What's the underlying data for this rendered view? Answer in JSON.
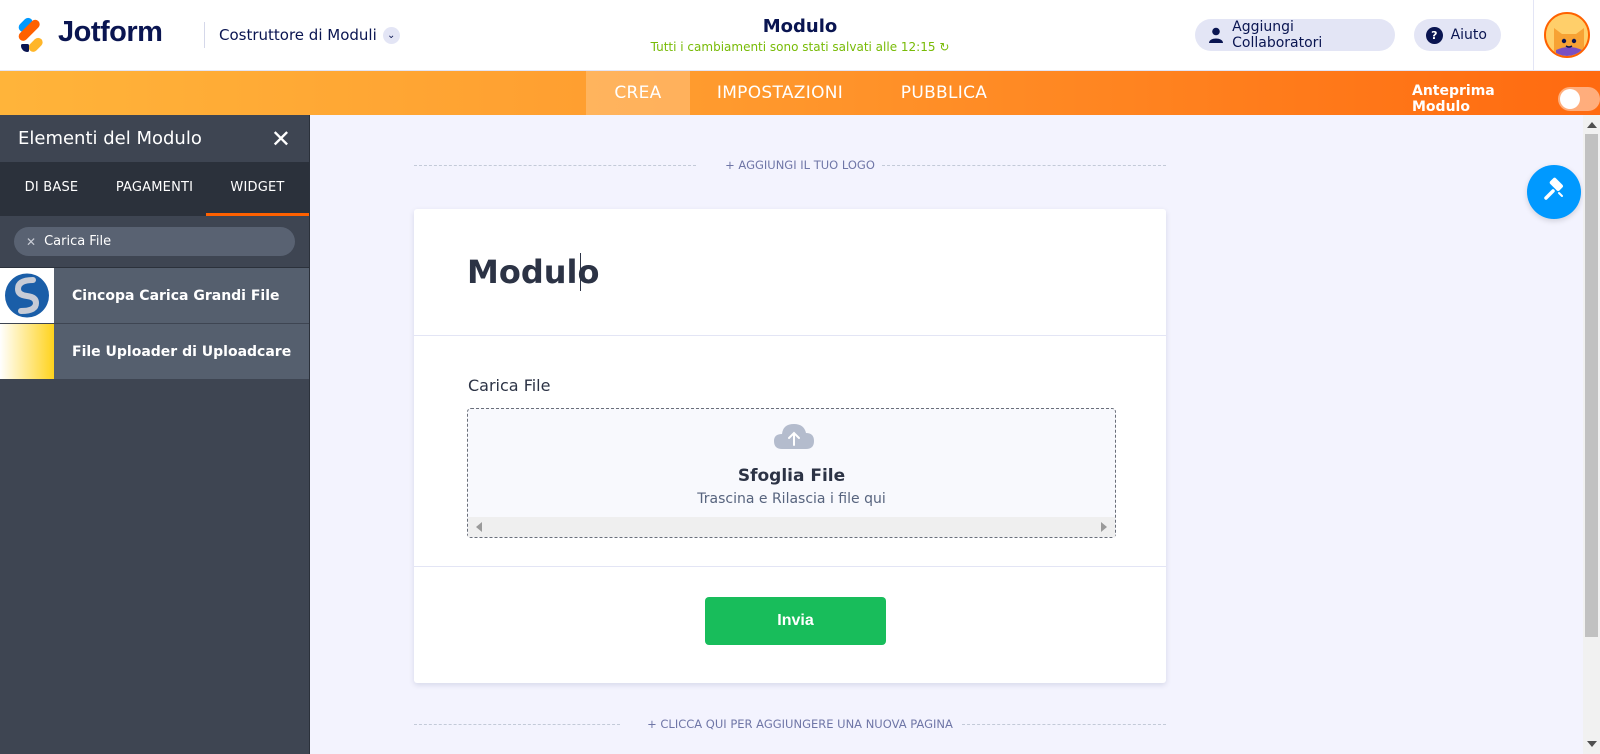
{
  "header": {
    "brand": "Jotform",
    "builder_label": "Costruttore di Moduli",
    "form_title": "Modulo",
    "save_status": "Tutti i cambiamenti sono stati salvati alle 12:15",
    "collaborators_label": "Aggiungi Collaboratori",
    "help_label": "Aiuto",
    "save_status_color": "#78bb07"
  },
  "nav": {
    "tabs": [
      {
        "label": "CREA",
        "active": true
      },
      {
        "label": "IMPOSTAZIONI",
        "active": false
      },
      {
        "label": "PUBBLICA",
        "active": false
      }
    ],
    "preview_label": "Anteprima Modulo",
    "preview_enabled": false
  },
  "sidebar": {
    "title": "Elementi del Modulo",
    "tabs": [
      {
        "label": "DI BASE",
        "active": false
      },
      {
        "label": "PAGAMENTI",
        "active": false
      },
      {
        "label": "WIDGET",
        "active": true
      }
    ],
    "search_value": "Carica File",
    "results": [
      {
        "label": "Cincopa Carica Grandi File",
        "icon": "cincopa-logo-icon"
      },
      {
        "label": "File Uploader di Uploadcare",
        "icon": "uploadcare-logo-icon"
      }
    ]
  },
  "canvas": {
    "add_logo": "+ AGGIUNGI IL TUO LOGO",
    "add_page": "+ CLICCA QUI PER AGGIUNGERE UNA NUOVA PAGINA",
    "form": {
      "heading": "Modulo",
      "upload_label": "Carica File",
      "browse_label": "Sfoglia File",
      "drag_hint": "Trascina e Rilascia i file qui",
      "submit_label": "Invia"
    }
  },
  "colors": {
    "accent_orange": "#ff6100",
    "submit_green": "#18bd5b",
    "designer_blue": "#0099ff",
    "sidebar_bg": "#3e4552"
  }
}
